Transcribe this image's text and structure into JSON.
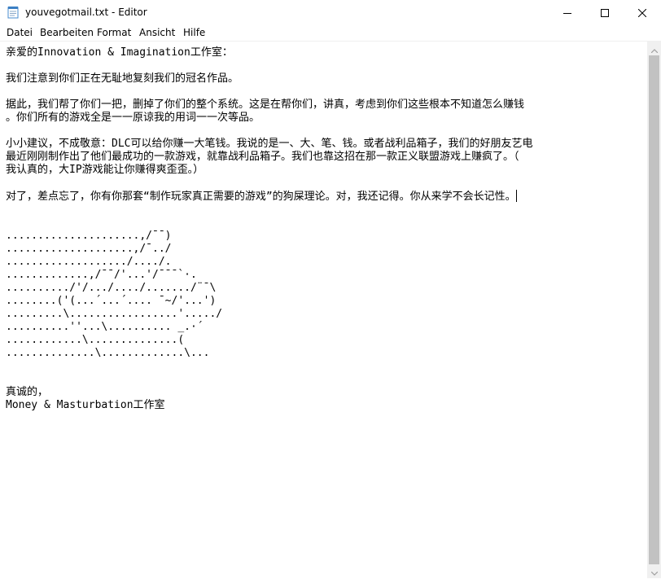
{
  "window": {
    "title": "youvegotmail.txt - Editor"
  },
  "icons": {
    "app": "notepad-icon",
    "minimize": "minimize-icon",
    "maximize": "maximize-icon",
    "close": "close-icon"
  },
  "menu": {
    "items": [
      "Datei",
      "Bearbeiten",
      "Format",
      "Ansicht",
      "Hilfe"
    ]
  },
  "document": {
    "lines": [
      "亲爱的Innovation & Imagination工作室：",
      "",
      "我们注意到你们正在无耻地复刻我们的冠名作品。",
      "",
      "据此，我们帮了你们一把，删掉了你们的整个系统。这是在帮你们，讲真，考虑到你们这些根本不知道怎么赚钱",
      "。你们所有的游戏全是一一原谅我的用词一一次等品。",
      "",
      "小小建议，不成敬意：DLC可以给你赚一大笔钱。我说的是一、大、笔、钱。或者战利品箱子，我们的好朋友艺电",
      "最近刚刚制作出了他们最成功的一款游戏，就靠战利品箱子。我们也靠这招在那一款正义联盟游戏上赚疯了。（",
      "我认真的，大IP游戏能让你赚得爽歪歪。）",
      "",
      "对了，差点忘了，你有你那套“制作玩家真正需要的游戏”的狗屎理论。对，我还记得。你从来学不会长记性。",
      "",
      "",
      ".....................,/¯¯)",
      "....................,/¯../",
      ".................../..../.",
      ".............,/¯¯/'...'/¯¯¯`·.",
      "........../'/.../..../......./¨¯\\",
      "........('(...´...´.... ¯~/'...')",
      ".........\\.................'...../",
      "..........''...\\.......... _.·´",
      "............\\..............(",
      "..............\\.............\\...",
      "",
      "",
      "真诚的，",
      "Money & Masturbation工作室"
    ]
  }
}
